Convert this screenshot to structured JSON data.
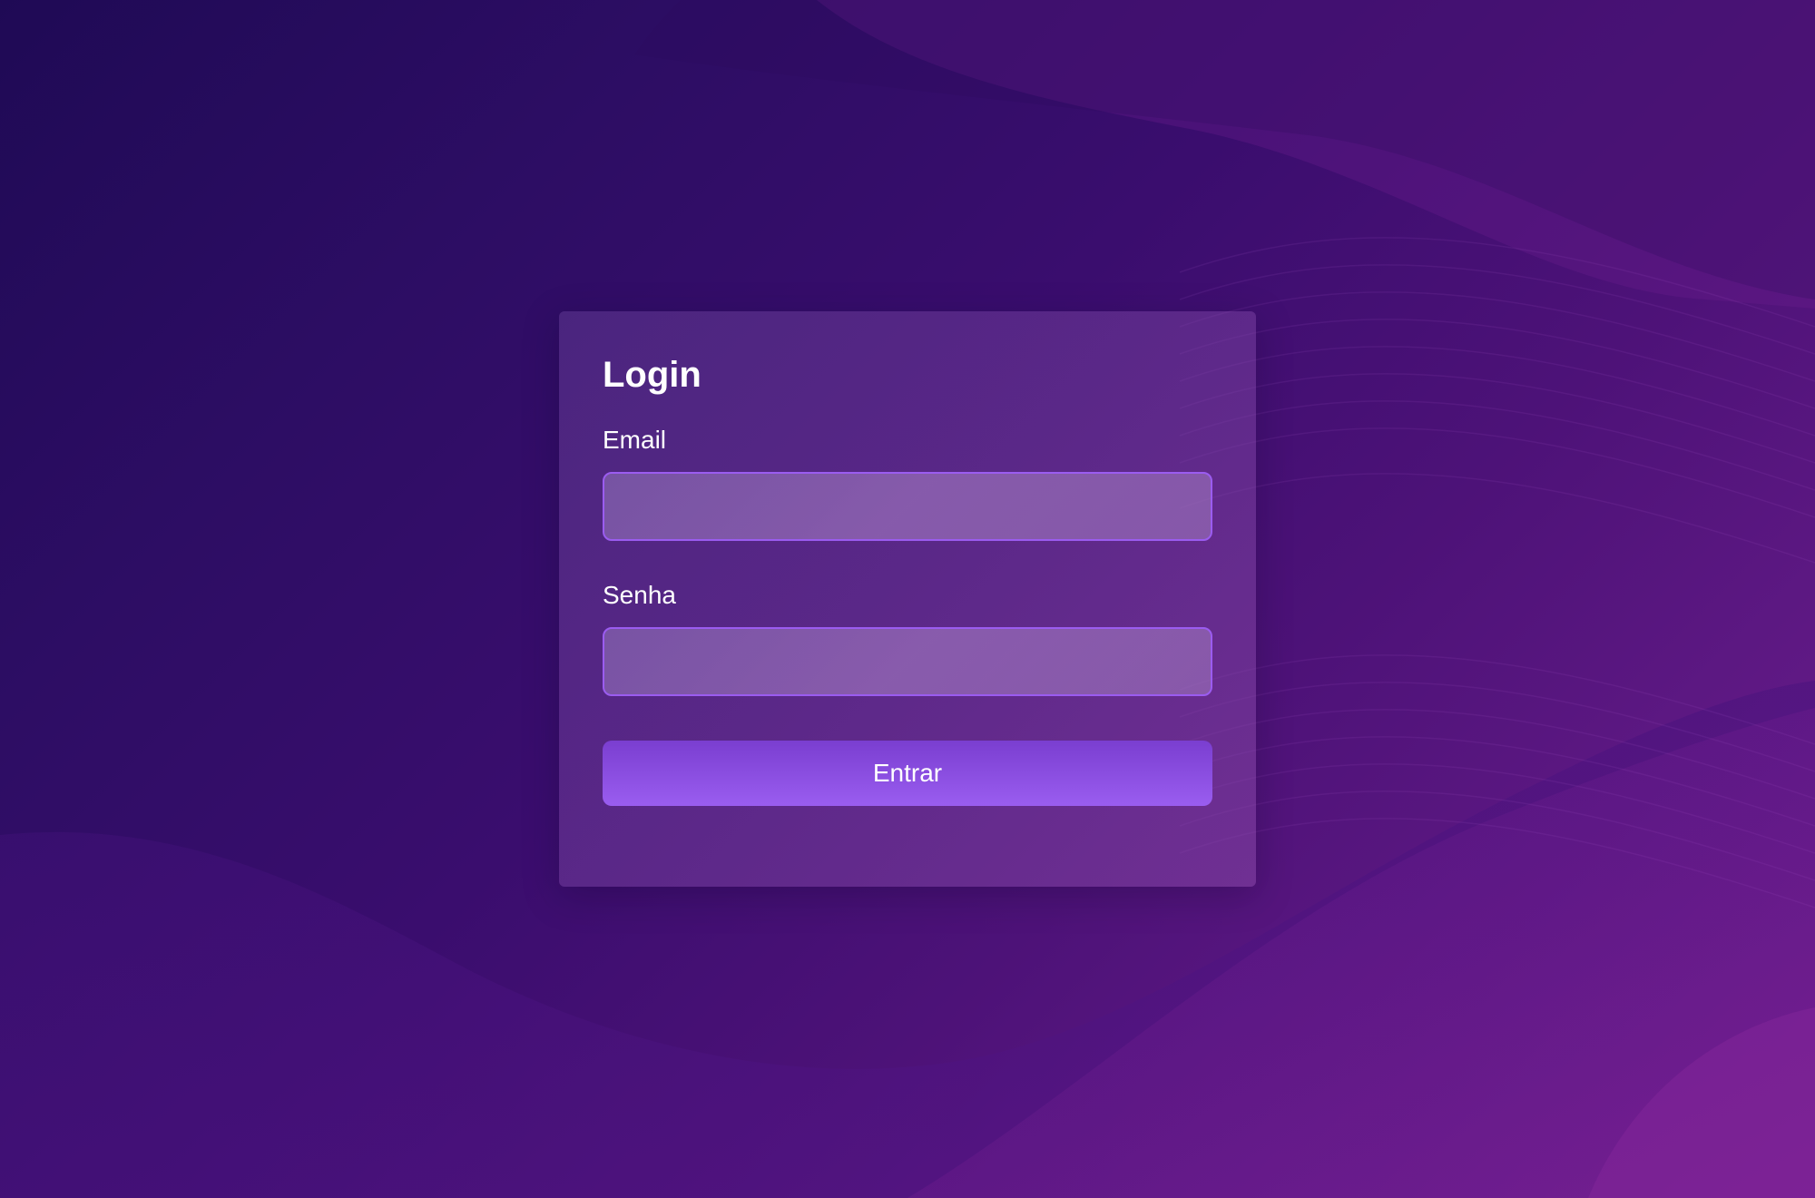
{
  "login": {
    "title": "Login",
    "email_label": "Email",
    "email_value": "",
    "email_placeholder": "",
    "password_label": "Senha",
    "password_value": "",
    "password_placeholder": "",
    "submit_label": "Entrar"
  },
  "colors": {
    "background_start": "#1f0a55",
    "background_end": "#7a2090",
    "accent": "#9b5cf0",
    "button_top": "#7a3ed0",
    "button_bottom": "#9a5df0",
    "text": "#ffffff"
  }
}
